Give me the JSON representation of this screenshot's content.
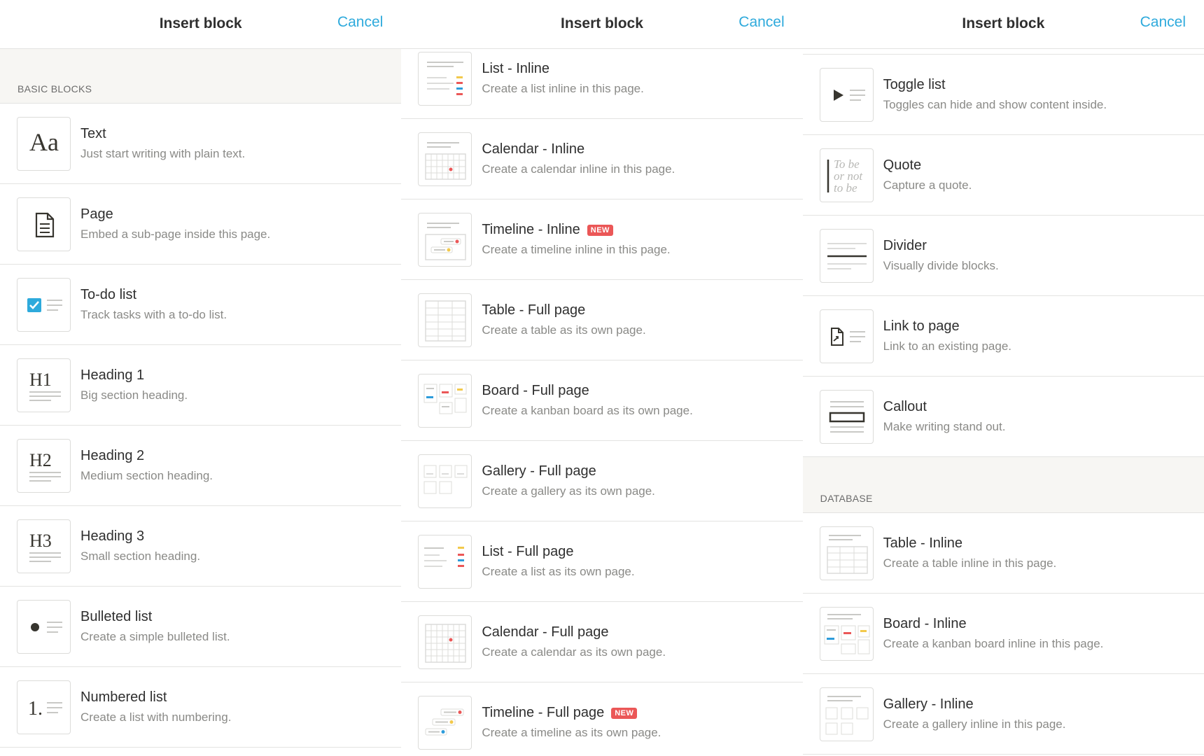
{
  "header": {
    "title": "Insert block",
    "cancel": "Cancel"
  },
  "panel1": {
    "section": "BASIC BLOCKS",
    "items": [
      {
        "title": "Text",
        "desc": "Just start writing with plain text."
      },
      {
        "title": "Page",
        "desc": "Embed a sub-page inside this page."
      },
      {
        "title": "To-do list",
        "desc": "Track tasks with a to-do list."
      },
      {
        "title": "Heading 1",
        "desc": "Big section heading."
      },
      {
        "title": "Heading 2",
        "desc": "Medium section heading."
      },
      {
        "title": "Heading 3",
        "desc": "Small section heading."
      },
      {
        "title": "Bulleted list",
        "desc": "Create a simple bulleted list."
      },
      {
        "title": "Numbered list",
        "desc": "Create a list with numbering."
      }
    ]
  },
  "panel2": {
    "items": [
      {
        "title": "List - Inline",
        "desc": "Create a list inline in this page."
      },
      {
        "title": "Calendar - Inline",
        "desc": "Create a calendar inline in this page."
      },
      {
        "title": "Timeline - Inline",
        "desc": "Create a timeline inline in this page.",
        "badge": "NEW"
      },
      {
        "title": "Table - Full page",
        "desc": "Create a table as its own page."
      },
      {
        "title": "Board - Full page",
        "desc": "Create a kanban board as its own page."
      },
      {
        "title": "Gallery - Full page",
        "desc": "Create a gallery as its own page."
      },
      {
        "title": "List - Full page",
        "desc": "Create a list as its own page."
      },
      {
        "title": "Calendar - Full page",
        "desc": "Create a calendar as its own page."
      },
      {
        "title": "Timeline - Full page",
        "desc": "Create a timeline as its own page.",
        "badge": "NEW"
      }
    ]
  },
  "panel3": {
    "items": [
      {
        "title": "Toggle list",
        "desc": "Toggles can hide and show content inside."
      },
      {
        "title": "Quote",
        "desc": "Capture a quote."
      },
      {
        "title": "Divider",
        "desc": "Visually divide blocks."
      },
      {
        "title": "Link to page",
        "desc": "Link to an existing page."
      },
      {
        "title": "Callout",
        "desc": "Make writing stand out."
      }
    ],
    "section": "DATABASE",
    "db_items": [
      {
        "title": "Table - Inline",
        "desc": "Create a table inline in this page."
      },
      {
        "title": "Board - Inline",
        "desc": "Create a kanban board inline in this page."
      },
      {
        "title": "Gallery - Inline",
        "desc": "Create a gallery inline in this page."
      }
    ]
  },
  "icons": {
    "text_glyph": "Aa",
    "h1_glyph": "H1",
    "h2_glyph": "H2",
    "h3_glyph": "H3",
    "numbered_glyph": "1.",
    "quote_lines": [
      "To be",
      "or not",
      "to be"
    ]
  },
  "colors": {
    "accent": "#2eaadc",
    "badge": "#eb5757",
    "check": "#2eaadc",
    "yellow": "#f2c94c",
    "red": "#eb5757",
    "blue": "#2d9cdb"
  }
}
